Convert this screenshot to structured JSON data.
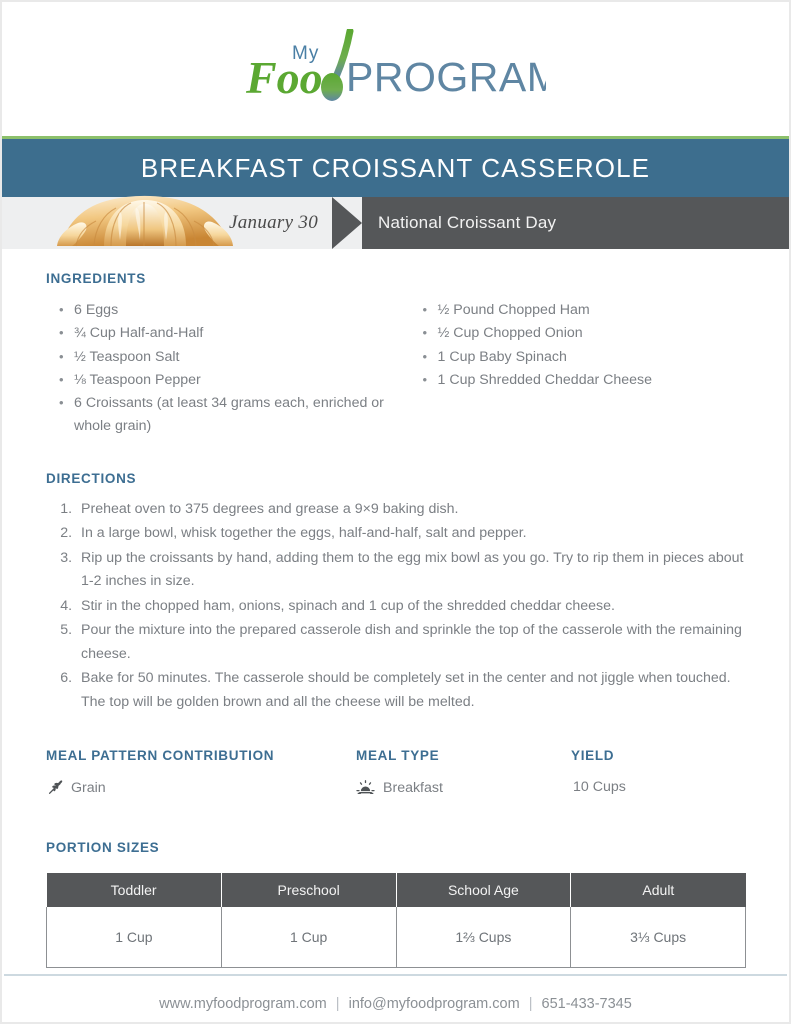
{
  "brand": {
    "logo_my": "My",
    "logo_food": "Food",
    "logo_program": "PROGRAM",
    "green": "#6cb33f",
    "blue": "#4a7fa5"
  },
  "header": {
    "title": "BREAKFAST CROISSANT CASSEROLE",
    "banner_color": "#3d6e8e",
    "accent_rule_color": "#8cc06b"
  },
  "date_band": {
    "date": "January 30",
    "holiday": "National Croissant Day",
    "left_bg": "#eeeff0",
    "right_bg": "#555759",
    "food_icon": "croissant-image"
  },
  "ingredients": {
    "heading": "INGREDIENTS",
    "left": [
      "6 Eggs",
      "¾ Cup Half-and-Half",
      "½ Teaspoon Salt",
      "⅛ Teaspoon Pepper",
      "6 Croissants (at least 34 grams each, enriched or whole grain)"
    ],
    "right": [
      "½ Pound Chopped Ham",
      "½ Cup Chopped Onion",
      "1 Cup Baby Spinach",
      "1 Cup Shredded Cheddar Cheese"
    ]
  },
  "directions": {
    "heading": "DIRECTIONS",
    "steps": [
      "Preheat oven to 375 degrees and grease a 9×9 baking dish.",
      "In a large bowl, whisk together the eggs, half-and-half, salt and pepper.",
      "Rip up the croissants by hand, adding them to the egg mix bowl as you go. Try to rip them in pieces about 1-2 inches in size.",
      "Stir in the chopped ham, onions, spinach and 1 cup of the shredded cheddar cheese.",
      "Pour the mixture into the prepared casserole dish and sprinkle the top of the casserole with the remaining cheese.",
      "Bake for 50 minutes. The casserole should be completely set in the center and not jiggle when touched. The top will be golden brown and all the cheese will be melted."
    ]
  },
  "meta": {
    "meal_pattern": {
      "heading": "MEAL PATTERN CONTRIBUTION",
      "value": "Grain",
      "icon": "wheat-grain-icon"
    },
    "meal_type": {
      "heading": "MEAL TYPE",
      "value": "Breakfast",
      "icon": "sunrise-icon"
    },
    "yield": {
      "heading": "YIELD",
      "value": "10 Cups"
    }
  },
  "portion_sizes": {
    "heading": "PORTION SIZES",
    "columns": [
      "Toddler",
      "Preschool",
      "School Age",
      "Adult"
    ],
    "values": [
      "1 Cup",
      "1 Cup",
      "1⅔ Cups",
      "3⅓ Cups"
    ]
  },
  "footer": {
    "website": "www.myfoodprogram.com",
    "email": "info@myfoodprogram.com",
    "phone": "651-433-7345",
    "separator": "|"
  }
}
